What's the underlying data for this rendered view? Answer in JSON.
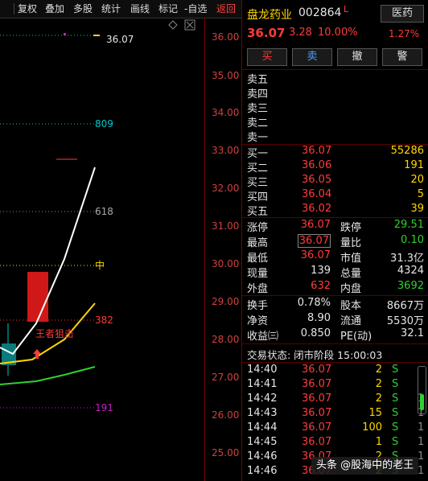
{
  "toolbar": {
    "items": [
      "复权",
      "叠加",
      "多股",
      "统计",
      "画线",
      "标记",
      "-自选",
      "返回"
    ]
  },
  "chart": {
    "price_labels": [
      "36.00",
      "35.00",
      "34.00",
      "33.00",
      "32.00",
      "31.00",
      "30.00",
      "29.00",
      "28.00",
      "27.00",
      "26.00",
      "25.00"
    ],
    "top_value": "36.07",
    "fib_labels": {
      "l809": "809",
      "l618": "618",
      "mid": "中",
      "l382": "382",
      "l191": "191"
    },
    "annotation": "王者狙击",
    "colors": {
      "up": "#ff3b3b",
      "down": "#2ed12e",
      "white_line": "#ffffff",
      "yellow_line": "#ffd700",
      "green_line": "#2ed12e",
      "cyan": "#00c8c8",
      "magenta": "#c020c0"
    }
  },
  "stock": {
    "name": "盘龙药业",
    "code": "002864",
    "flag": "L",
    "sector": "医药",
    "sector_change": "1.27%",
    "price": "36.07",
    "change": "3.28",
    "change_pct": "10.00%"
  },
  "buttons": {
    "buy": "买",
    "sell": "卖",
    "cancel": "撤",
    "alert": "警"
  },
  "asks": [
    "卖五",
    "卖四",
    "卖三",
    "卖二",
    "卖一"
  ],
  "bids": [
    {
      "label": "买一",
      "price": "36.07",
      "vol": "55286"
    },
    {
      "label": "买二",
      "price": "36.06",
      "vol": "191"
    },
    {
      "label": "买三",
      "price": "36.05",
      "vol": "20"
    },
    {
      "label": "买四",
      "price": "36.04",
      "vol": "5"
    },
    {
      "label": "买五",
      "price": "36.02",
      "vol": "39"
    }
  ],
  "stats": {
    "zt_label": "涨停",
    "zt": "36.07",
    "dt_label": "跌停",
    "dt": "29.51",
    "zg_label": "最高",
    "zg": "36.07",
    "lb_label": "量比",
    "lb": "0.10",
    "zd_label": "最低",
    "zd": "36.07",
    "sz_label": "市值",
    "sz": "31.3亿",
    "xl_label": "现量",
    "xl": "139",
    "zl_label": "总量",
    "zl": "4324",
    "wp_label": "外盘",
    "wp": "632",
    "np_label": "内盘",
    "np": "3692",
    "hs_label": "换手",
    "hs": "0.78%",
    "gb_label": "股本",
    "gb": "8667万",
    "jz_label": "净资",
    "jz": "8.90",
    "lt_label": "流通",
    "lt": "5530万",
    "sy_label": "收益㈢",
    "sy": "0.850",
    "pe_label": "PE(动)",
    "pe": "32.1"
  },
  "trade_status": "交易状态: 闭市阶段 15:00:03",
  "ticks": [
    {
      "time": "14:40",
      "price": "36.07",
      "vol": "2",
      "bs": "S",
      "n": "1"
    },
    {
      "time": "14:41",
      "price": "36.07",
      "vol": "2",
      "bs": "S",
      "n": "1"
    },
    {
      "time": "14:42",
      "price": "36.07",
      "vol": "2",
      "bs": "S",
      "n": "1"
    },
    {
      "time": "14:43",
      "price": "36.07",
      "vol": "15",
      "bs": "S",
      "n": "1"
    },
    {
      "time": "14:44",
      "price": "36.07",
      "vol": "100",
      "bs": "S",
      "n": "1"
    },
    {
      "time": "14:45",
      "price": "36.07",
      "vol": "1",
      "bs": "S",
      "n": "1"
    },
    {
      "time": "14:46",
      "price": "36.07",
      "vol": "2",
      "bs": "S",
      "n": "1"
    },
    {
      "time": "14:46",
      "price": "36.07",
      "vol": "2",
      "bs": "S",
      "n": "1"
    }
  ],
  "watermark": "头条 @股海中的老王"
}
